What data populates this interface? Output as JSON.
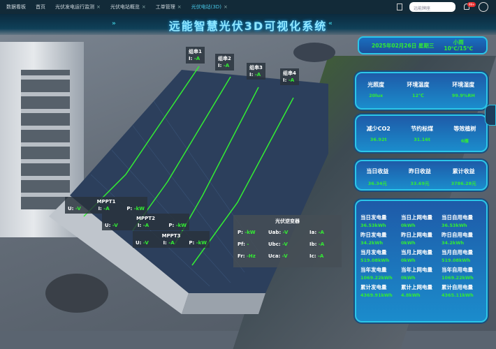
{
  "nav": {
    "items": [
      {
        "label": "数据看板",
        "closable": false
      },
      {
        "label": "首页",
        "closable": false
      },
      {
        "label": "光伏发电运行监测",
        "closable": true
      },
      {
        "label": "光伏电站概览",
        "closable": true
      },
      {
        "label": "工单管理",
        "closable": true
      },
      {
        "label": "光伏电站(3D)",
        "closable": true,
        "active": true
      }
    ],
    "close_glyph": "×",
    "search_placeholder": "远能牌座",
    "badge": "99+"
  },
  "title": "远能智慧光伏3D可视化系统",
  "strings": [
    {
      "name": "组串1",
      "i": "-A"
    },
    {
      "name": "组串2",
      "i": "-A"
    },
    {
      "name": "组串3",
      "i": "-A"
    },
    {
      "name": "组串4",
      "i": "-A"
    }
  ],
  "labels": {
    "i": "I:",
    "u": "U:",
    "p": "P:"
  },
  "mppt": [
    {
      "name": "MPPT1",
      "u": "-V",
      "i": "-A",
      "p": "-kW"
    },
    {
      "name": "MPPT2",
      "u": "-V",
      "i": "-A",
      "p": "-kW"
    },
    {
      "name": "MPPT3",
      "u": "-V",
      "i": "-A",
      "p": "-kW"
    }
  ],
  "inverter": {
    "title": "光伏逆变器",
    "rows": [
      [
        {
          "k": "P:",
          "v": "-kW"
        },
        {
          "k": "Uab:",
          "v": "-V"
        },
        {
          "k": "Ia:",
          "v": "-A"
        }
      ],
      [
        {
          "k": "Pf:",
          "v": "-"
        },
        {
          "k": "Ubc:",
          "v": "-V"
        },
        {
          "k": "Ib:",
          "v": "-A"
        }
      ],
      [
        {
          "k": "Fr:",
          "v": "-Hz"
        },
        {
          "k": "Uca:",
          "v": "-V"
        },
        {
          "k": "Ic:",
          "v": "-A"
        }
      ]
    ]
  },
  "date": {
    "date": "2025年02月26日 星期三",
    "weather": "小雨",
    "temp": "10℃/15℃"
  },
  "env": [
    {
      "label": "光照度",
      "value": "20lux"
    },
    {
      "label": "环境温度",
      "value": "12℃"
    },
    {
      "label": "环境湿度",
      "value": "99.9%RH"
    }
  ],
  "eco": [
    {
      "label": "减少CO2",
      "value": "36.92t"
    },
    {
      "label": "节约标煤",
      "value": "31.16t"
    },
    {
      "label": "等效植树",
      "value": "6棵"
    }
  ],
  "income": [
    {
      "label": "当日收益",
      "value": "36.34元"
    },
    {
      "label": "昨日收益",
      "value": "33.69元"
    },
    {
      "label": "累计收益",
      "value": "3786.28元"
    }
  ],
  "energy": [
    {
      "label": "当日发电量",
      "value": "36.53kWh"
    },
    {
      "label": "当日上网电量",
      "value": "0kWh"
    },
    {
      "label": "当日自用电量",
      "value": "36.53kWh"
    },
    {
      "label": "昨日发电量",
      "value": "34.2kWh"
    },
    {
      "label": "昨日上网电量",
      "value": "0kWh"
    },
    {
      "label": "昨日自用电量",
      "value": "34.2kWh"
    },
    {
      "label": "当月发电量",
      "value": "519.08kWh"
    },
    {
      "label": "当月上网电量",
      "value": "0kWh"
    },
    {
      "label": "当月自用电量",
      "value": "519.08kWh"
    },
    {
      "label": "当年发电量",
      "value": "1069.22kWh"
    },
    {
      "label": "当年上网电量",
      "value": "0kWh"
    },
    {
      "label": "当年自用电量",
      "value": "1069.22kWh"
    },
    {
      "label": "累计发电量",
      "value": "4369.91kWh"
    },
    {
      "label": "累计上网电量",
      "value": "4.8kWh"
    },
    {
      "label": "累计自用电量",
      "value": "4365.11kWh"
    }
  ],
  "colors": {
    "accent": "#33ee33",
    "title": "#8ee6ff",
    "panel_border": "#2bc6e8"
  }
}
